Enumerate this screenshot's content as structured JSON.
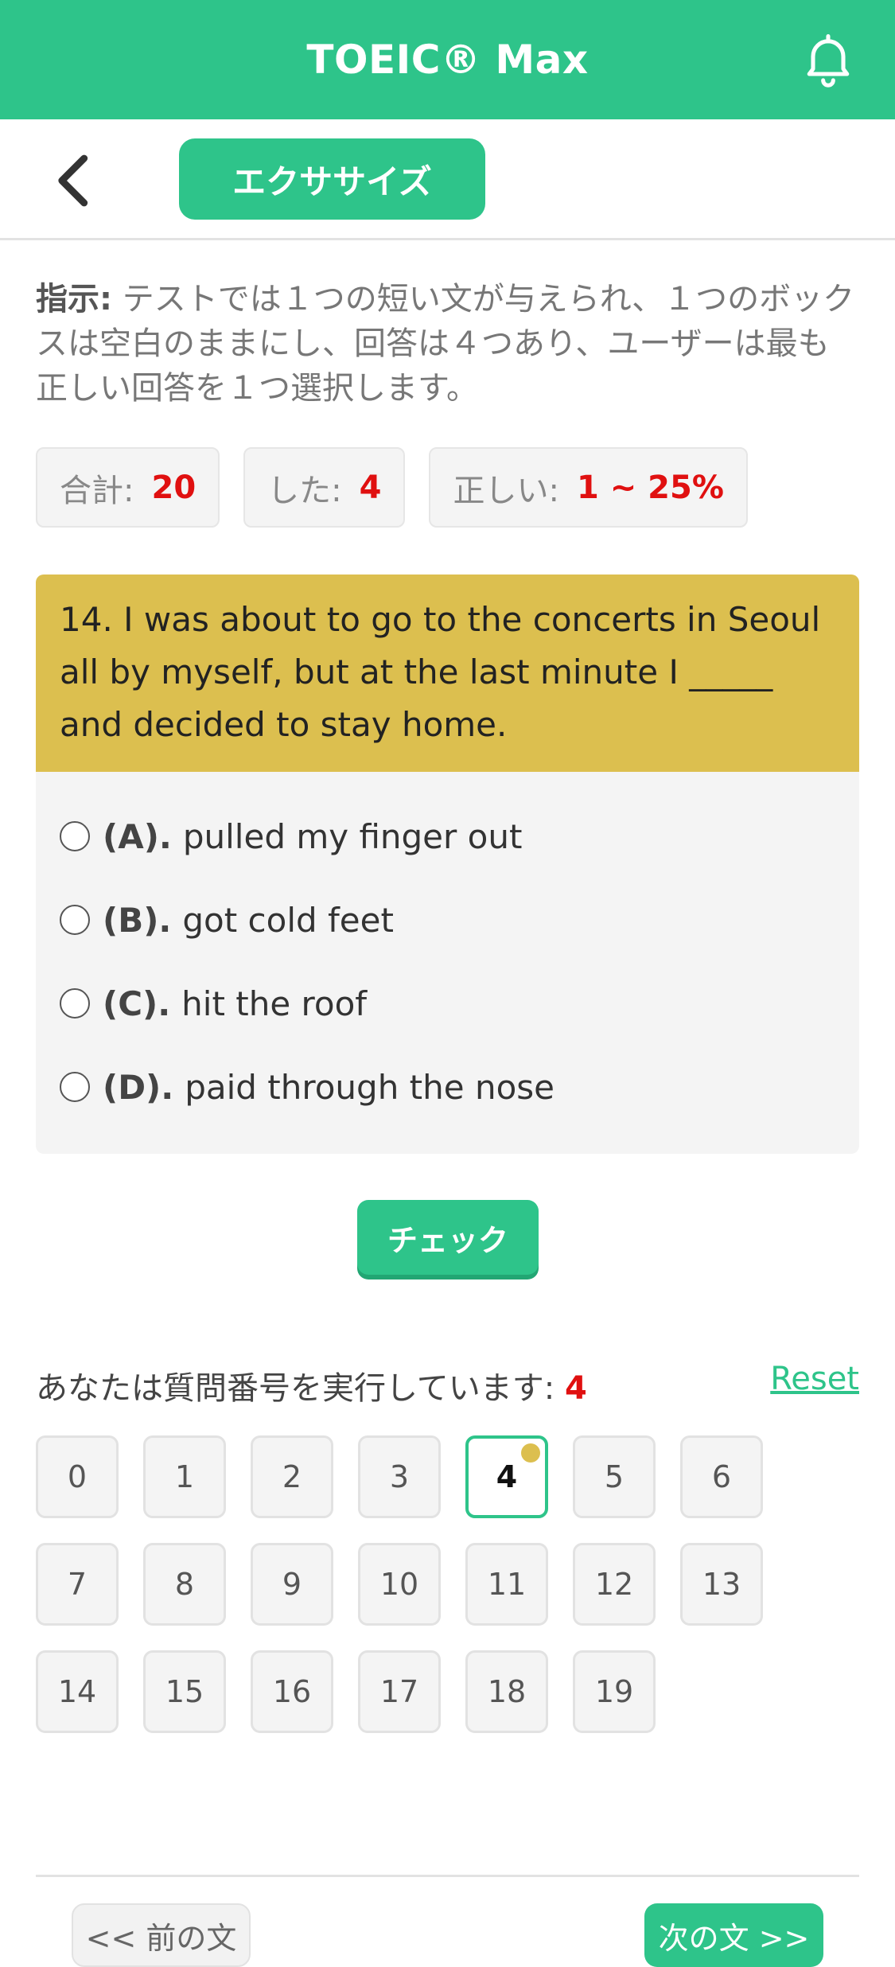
{
  "header": {
    "app_title": "TOEIC® Max",
    "notification_icon": "bell-icon"
  },
  "subbar": {
    "back_icon": "chevron-left-icon",
    "tab_label": "エクササイズ"
  },
  "instructions": {
    "label": "指示:",
    "text": " テストでは１つの短い文が与えられ、１つのボックスは空白のままにし、回答は４つあり、ユーザーは最も正しい回答を１つ選択します。"
  },
  "stats": {
    "total_label": "合計:",
    "total_value": "20",
    "done_label": "した:",
    "done_value": "4",
    "correct_label": "正しい:",
    "correct_value": "1 ~ 25%"
  },
  "question": {
    "text": "14. I was about to go to the concerts in Seoul all by myself, but at the last minute I _____ and decided to stay home.",
    "options": [
      {
        "letter": "(A).",
        "text": "pulled my finger out"
      },
      {
        "letter": "(B).",
        "text": "got cold feet"
      },
      {
        "letter": "(C).",
        "text": "hit the roof"
      },
      {
        "letter": "(D).",
        "text": "paid through the nose"
      }
    ]
  },
  "check_label": "チェック",
  "progress": {
    "label": "あなたは質問番号を実行しています:",
    "current": "4",
    "reset_label": "Reset"
  },
  "question_numbers": [
    "0",
    "1",
    "2",
    "3",
    "4",
    "5",
    "6",
    "7",
    "8",
    "9",
    "10",
    "11",
    "12",
    "13",
    "14",
    "15",
    "16",
    "17",
    "18",
    "19"
  ],
  "nav": {
    "prev_label": "<< 前の文",
    "next_label": "次の文 >>"
  },
  "colors": {
    "accent": "#2ec48a",
    "question_header": "#dcbf4f",
    "highlight": "#e01010"
  }
}
